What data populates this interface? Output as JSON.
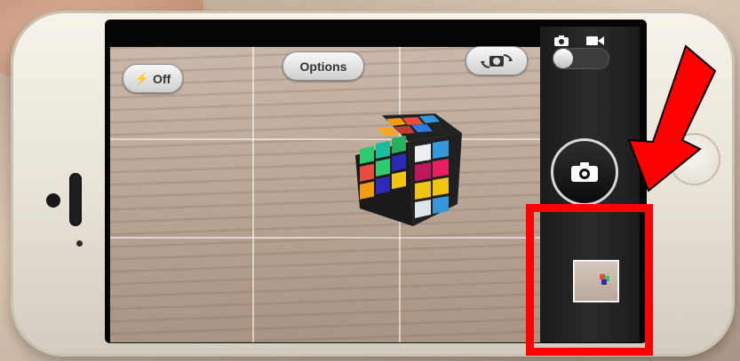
{
  "camera": {
    "flash_label": "Off",
    "options_label": "Options"
  },
  "icons": {
    "flash": "lightning-bolt",
    "switch_camera": "camera-rotate",
    "photo_mode": "still-camera",
    "video_mode": "video-camera",
    "shutter": "camera"
  },
  "mode_switch": {
    "selected": "photo"
  },
  "annotations": {
    "arrow_color": "#ff0000",
    "box_color": "#ff0000"
  }
}
